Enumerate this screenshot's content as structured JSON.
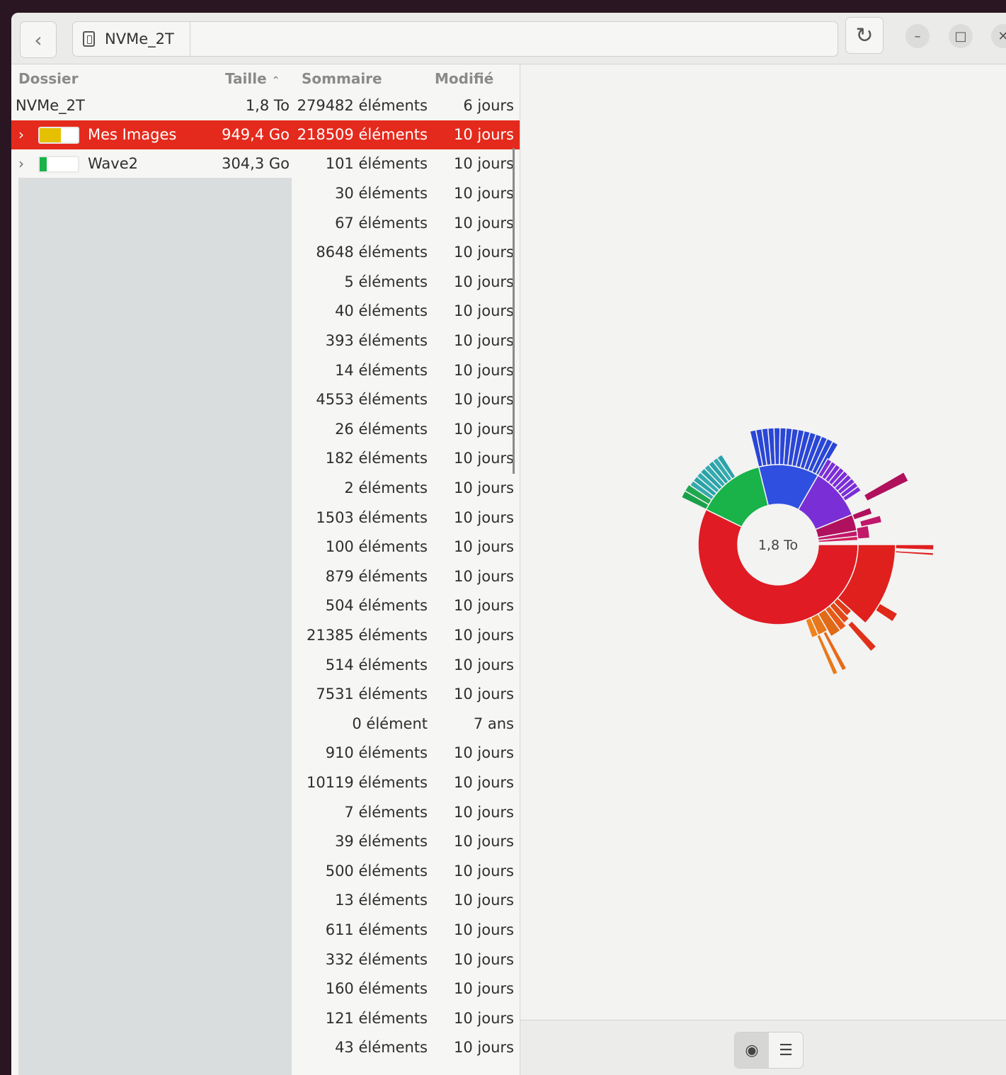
{
  "header": {
    "path_label": "NVMe_2T"
  },
  "columns": {
    "folder": "Dossier",
    "size": "Taille",
    "summary": "Sommaire",
    "modified": "Modifié"
  },
  "root": {
    "name": "NVMe_2T",
    "size": "1,8 To",
    "summary": "279482 éléments",
    "modified": "6 jours"
  },
  "selected": {
    "name": "Mes Images",
    "size": "949,4 Go",
    "summary": "218509 éléments",
    "modified": "10 jours",
    "color": "#e4c000"
  },
  "partial_row": {
    "name": "Wave2",
    "size": "304,3 Go",
    "summary": "101 éléments",
    "modified": "10 jours"
  },
  "rows": [
    {
      "summary": "30 éléments",
      "modified": "10 jours"
    },
    {
      "summary": "67 éléments",
      "modified": "10 jours"
    },
    {
      "summary": "8648 éléments",
      "modified": "10 jours"
    },
    {
      "summary": "5 éléments",
      "modified": "10 jours"
    },
    {
      "summary": "40 éléments",
      "modified": "10 jours"
    },
    {
      "summary": "393 éléments",
      "modified": "10 jours"
    },
    {
      "summary": "14 éléments",
      "modified": "10 jours"
    },
    {
      "summary": "4553 éléments",
      "modified": "10 jours"
    },
    {
      "summary": "26 éléments",
      "modified": "10 jours"
    },
    {
      "summary": "182 éléments",
      "modified": "10 jours"
    },
    {
      "summary": "2 éléments",
      "modified": "10 jours"
    },
    {
      "summary": "1503 éléments",
      "modified": "10 jours"
    },
    {
      "summary": "100 éléments",
      "modified": "10 jours"
    },
    {
      "summary": "879 éléments",
      "modified": "10 jours"
    },
    {
      "summary": "504 éléments",
      "modified": "10 jours"
    },
    {
      "summary": "21385 éléments",
      "modified": "10 jours"
    },
    {
      "summary": "514 éléments",
      "modified": "10 jours"
    },
    {
      "summary": "7531 éléments",
      "modified": "10 jours"
    },
    {
      "summary": "0 élément",
      "modified": "7 ans"
    },
    {
      "summary": "910 éléments",
      "modified": "10 jours"
    },
    {
      "summary": "10119 éléments",
      "modified": "10 jours"
    },
    {
      "summary": "7 éléments",
      "modified": "10 jours"
    },
    {
      "summary": "39 éléments",
      "modified": "10 jours"
    },
    {
      "summary": "500 éléments",
      "modified": "10 jours"
    },
    {
      "summary": "13 éléments",
      "modified": "10 jours"
    },
    {
      "summary": "611 éléments",
      "modified": "10 jours"
    },
    {
      "summary": "332 éléments",
      "modified": "10 jours"
    },
    {
      "summary": "160 éléments",
      "modified": "10 jours"
    },
    {
      "summary": "121 éléments",
      "modified": "10 jours"
    },
    {
      "summary": "43 éléments",
      "modified": "10 jours"
    }
  ],
  "chart": {
    "center_label": "1,8 To",
    "colors": {
      "red": "#e01b24",
      "green": "#19b34a",
      "blue": "#2f4fe0",
      "purple": "#7a2fd6",
      "magenta": "#b0115e",
      "teal": "#2e9aa6"
    }
  },
  "icons": {
    "back": "go-previous-icon",
    "drive": "drive-icon",
    "refresh": "view-refresh-icon",
    "minimize": "minimize-icon",
    "maximize": "maximize-icon",
    "close": "close-icon",
    "chart_view": "ring-chart-icon",
    "details_view": "details-icon"
  }
}
